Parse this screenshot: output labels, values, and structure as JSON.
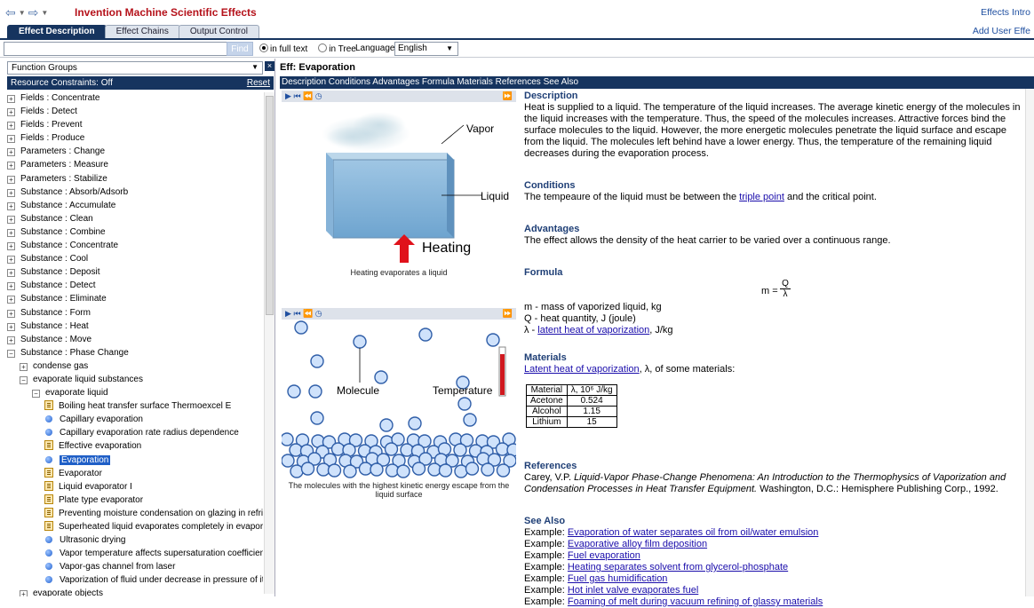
{
  "window": {
    "title": "Invention Machine Scientific Effects",
    "effects_intro": "Effects Intro",
    "add_user_effect": "Add User Effe"
  },
  "tabs": [
    {
      "label": "Effect Description",
      "active": true
    },
    {
      "label": "Effect Chains",
      "active": false
    },
    {
      "label": "Output Control",
      "active": false
    }
  ],
  "search": {
    "value": "",
    "find_label": "Find",
    "in_full_text": "in full text",
    "in_tree": "in Tree",
    "selected": "in full text",
    "language_label": "Language:",
    "language_value": "English"
  },
  "left": {
    "dropdown": "Function Groups",
    "constraints": "Resource Constraints: Off",
    "reset": "Reset",
    "tree": [
      {
        "label": "Fields : Concentrate",
        "type": "box",
        "exp": "+",
        "lvl": 0
      },
      {
        "label": "Fields : Detect",
        "type": "box",
        "exp": "+",
        "lvl": 0
      },
      {
        "label": "Fields : Prevent",
        "type": "box",
        "exp": "+",
        "lvl": 0
      },
      {
        "label": "Fields : Produce",
        "type": "box",
        "exp": "+",
        "lvl": 0
      },
      {
        "label": "Parameters : Change",
        "type": "box",
        "exp": "+",
        "lvl": 0
      },
      {
        "label": "Parameters : Measure",
        "type": "box",
        "exp": "+",
        "lvl": 0
      },
      {
        "label": "Parameters : Stabilize",
        "type": "box",
        "exp": "+",
        "lvl": 0
      },
      {
        "label": "Substance : Absorb/Adsorb",
        "type": "box",
        "exp": "+",
        "lvl": 0
      },
      {
        "label": "Substance : Accumulate",
        "type": "box",
        "exp": "+",
        "lvl": 0
      },
      {
        "label": "Substance : Clean",
        "type": "box",
        "exp": "+",
        "lvl": 0
      },
      {
        "label": "Substance : Combine",
        "type": "box",
        "exp": "+",
        "lvl": 0
      },
      {
        "label": "Substance : Concentrate",
        "type": "box",
        "exp": "+",
        "lvl": 0
      },
      {
        "label": "Substance : Cool",
        "type": "box",
        "exp": "+",
        "lvl": 0
      },
      {
        "label": "Substance : Deposit",
        "type": "box",
        "exp": "+",
        "lvl": 0
      },
      {
        "label": "Substance : Detect",
        "type": "box",
        "exp": "+",
        "lvl": 0
      },
      {
        "label": "Substance : Eliminate",
        "type": "box",
        "exp": "+",
        "lvl": 0
      },
      {
        "label": "Substance : Form",
        "type": "box",
        "exp": "+",
        "lvl": 0
      },
      {
        "label": "Substance : Heat",
        "type": "box",
        "exp": "+",
        "lvl": 0
      },
      {
        "label": "Substance : Move",
        "type": "box",
        "exp": "+",
        "lvl": 0
      },
      {
        "label": "Substance : Phase Change",
        "type": "box",
        "exp": "−",
        "lvl": 0
      },
      {
        "label": "condense gas",
        "type": "box",
        "exp": "+",
        "lvl": 1
      },
      {
        "label": "evaporate liquid substances",
        "type": "box",
        "exp": "−",
        "lvl": 1
      },
      {
        "label": "evaporate liquid",
        "type": "box",
        "exp": "−",
        "lvl": 2
      },
      {
        "label": "Boiling heat transfer surface Thermoexcel E",
        "type": "doc",
        "lvl": 3
      },
      {
        "label": "Capillary evaporation",
        "type": "dot",
        "lvl": 3
      },
      {
        "label": "Capillary evaporation rate radius dependence",
        "type": "dot",
        "lvl": 3
      },
      {
        "label": "Effective evaporation",
        "type": "doc",
        "lvl": 3
      },
      {
        "label": "Evaporation",
        "type": "dot",
        "lvl": 3,
        "selected": true
      },
      {
        "label": "Evaporator",
        "type": "doc",
        "lvl": 3
      },
      {
        "label": "Liquid evaporator I",
        "type": "doc",
        "lvl": 3
      },
      {
        "label": "Plate type evaporator",
        "type": "doc",
        "lvl": 3
      },
      {
        "label": "Preventing moisture condensation on glazing in refrigerated ...",
        "type": "doc",
        "lvl": 3
      },
      {
        "label": "Superheated liquid evaporates completely in evaporator",
        "type": "doc",
        "lvl": 3
      },
      {
        "label": "Ultrasonic drying",
        "type": "dot",
        "lvl": 3
      },
      {
        "label": "Vapor temperature affects supersaturation coefficient",
        "type": "dot",
        "lvl": 3
      },
      {
        "label": "Vapor-gas channel from laser",
        "type": "dot",
        "lvl": 3
      },
      {
        "label": "Vaporization of fluid under decrease in pressure of its saturat...",
        "type": "dot",
        "lvl": 3
      },
      {
        "label": "evaporate objects",
        "type": "box",
        "exp": "+",
        "lvl": 1
      }
    ]
  },
  "effect": {
    "title": "Eff: Evaporation",
    "menu": "Description Conditions Advantages Formula Materials References See Also",
    "fig1": {
      "vapor": "Vapor",
      "liquid": "Liquid",
      "heating": "Heating",
      "caption": "Heating evaporates a liquid"
    },
    "fig2": {
      "molecule": "Molecule",
      "temperature": "Temperature",
      "caption": "The molecules with the highest kinetic energy escape from the liquid surface"
    },
    "description_h": "Description",
    "description": "Heat is supplied to a liquid.  The temperature of the liquid increases.  The average kinetic energy of the molecules in the liquid increases with the temperature.  Thus, the speed of the molecules increases.  Attractive forces bind the surface molecules to the liquid.  However, the more energetic molecules penetrate the liquid surface and escape from the liquid.  The molecules left behind have a lower energy.  Thus, the temperature of the remaining liquid decreases during the evaporation process.",
    "conditions_h": "Conditions",
    "conditions_pre": "The tempeaure of the liquid must be between the ",
    "conditions_link": "triple point",
    "conditions_post": " and the critical point.",
    "advantages_h": "Advantages",
    "advantages": "The effect allows the density of the heat carrier to be varied over a continuous range.",
    "formula_h": "Formula",
    "formula_lhs": "m =",
    "formula_num": "Q",
    "formula_den": "λ",
    "formula_m": "m - mass of vaporized liquid, kg",
    "formula_q": "Q - heat quantity, J (joule)",
    "formula_l_pre": "λ - ",
    "formula_l_link": "latent heat of vaporization",
    "formula_l_post": ", J/kg",
    "materials_h": "Materials",
    "materials_link": "Latent heat of vaporization",
    "materials_post": ", λ, of some materials:",
    "materials_table": {
      "header": [
        "Material",
        "λ, 10⁶ J/kg"
      ],
      "rows": [
        [
          "Acetone",
          "0.524"
        ],
        [
          "Alcohol",
          "1.15"
        ],
        [
          "Lithium",
          "15"
        ]
      ]
    },
    "references_h": "References",
    "ref_pre": "Carey, V.P.  ",
    "ref_title": "Liquid-Vapor Phase-Change Phenomena: An Introduction to the Thermophysics of Vaporization and Condensation Processes in Heat Transfer Equipment.",
    "ref_post": "  Washington, D.C.: Hemisphere Publishing Corp., 1992.",
    "seealso_h": "See Also",
    "seealso": [
      {
        "prefix": "Example: ",
        "link": "Evaporation of water separates oil from oil/water emulsion"
      },
      {
        "prefix": "Example: ",
        "link": "Evaporative alloy film deposition"
      },
      {
        "prefix": "Example: ",
        "link": "Fuel evaporation"
      },
      {
        "prefix": "Example: ",
        "link": "Heating separates solvent from glycerol-phosphate"
      },
      {
        "prefix": "Example: ",
        "link": "Fuel gas humidification"
      },
      {
        "prefix": "Example: ",
        "link": "Hot inlet valve evaporates fuel"
      },
      {
        "prefix": "Example: ",
        "link": "Foaming of melt during vacuum refining of glassy materials"
      }
    ]
  },
  "colors": {
    "navy": "#16345f",
    "title_red": "#b5121b",
    "link": "#1a0dab",
    "heading": "#1f3f76"
  }
}
